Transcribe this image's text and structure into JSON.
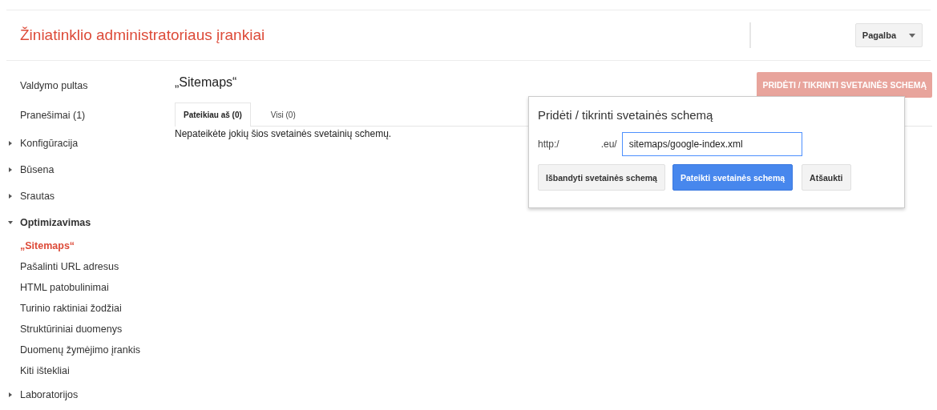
{
  "header": {
    "title": "Žiniatinklio administratoriaus įrankiai",
    "help_button": "Pagalba"
  },
  "sidebar": {
    "items": [
      {
        "label": "Valdymo pultas",
        "kind": "link"
      },
      {
        "label": "Pranešimai (1)",
        "kind": "link"
      },
      {
        "label": "Konfigūracija",
        "kind": "section",
        "expanded": false
      },
      {
        "label": "Būsena",
        "kind": "section",
        "expanded": false
      },
      {
        "label": "Srautas",
        "kind": "section",
        "expanded": false
      },
      {
        "label": "Optimizavimas",
        "kind": "section",
        "expanded": true,
        "children": [
          {
            "label": "„Sitemaps“",
            "selected": true
          },
          {
            "label": "Pašalinti URL adresus",
            "selected": false
          },
          {
            "label": "HTML patobulinimai",
            "selected": false
          },
          {
            "label": "Turinio raktiniai žodžiai",
            "selected": false
          },
          {
            "label": "Struktūriniai duomenys",
            "selected": false
          },
          {
            "label": "Duomenų žymėjimo įrankis",
            "selected": false
          },
          {
            "label": "Kiti ištekliai",
            "selected": false
          }
        ]
      },
      {
        "label": "Laboratorijos",
        "kind": "section",
        "expanded": false
      }
    ]
  },
  "main": {
    "title": "„Sitemaps“",
    "add_button": "PRIDĖTI / TIKRINTI SVETAINĖS SCHEMĄ",
    "tabs": [
      {
        "label": "Pateikiau aš (0)",
        "selected": true
      },
      {
        "label": "Visi (0)",
        "selected": false
      }
    ],
    "empty_message": "Nepateikėte jokių šios svetainės svetainių schemų."
  },
  "dialog": {
    "title": "Pridėti / tikrinti svetainės schemą",
    "url_prefix": "http:/",
    "url_domain": ".eu/",
    "path_value": "sitemaps/google-index.xml",
    "buttons": [
      {
        "label": "Išbandyti svetainės schemą",
        "kind": "default"
      },
      {
        "label": "Pateikti svetainės schemą",
        "kind": "primary"
      },
      {
        "label": "Atšaukti",
        "kind": "default"
      }
    ]
  }
}
